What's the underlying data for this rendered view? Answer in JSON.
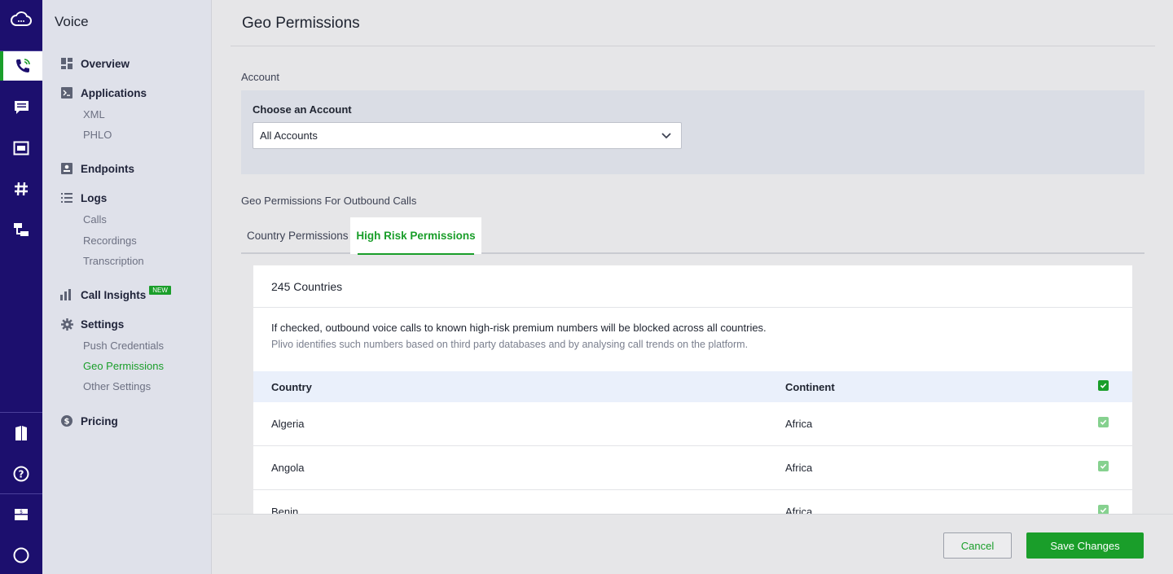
{
  "rail": {
    "items": [
      "cloud-icon",
      "phone-icon",
      "message-icon",
      "sip-icon",
      "hash-icon",
      "flow-icon",
      "book-icon",
      "help-icon",
      "billing-icon",
      "account-icon"
    ],
    "active": "phone-icon"
  },
  "subnav": {
    "title": "Voice",
    "overview": "Overview",
    "applications": "Applications",
    "xml": "XML",
    "phlo": "PHLO",
    "endpoints": "Endpoints",
    "logs": "Logs",
    "calls": "Calls",
    "recordings": "Recordings",
    "transcription": "Transcription",
    "call_insights": "Call Insights",
    "new_badge": "NEW",
    "settings": "Settings",
    "push_credentials": "Push Credentials",
    "geo_permissions": "Geo Permissions",
    "other_settings": "Other Settings",
    "pricing": "Pricing"
  },
  "page": {
    "title": "Geo Permissions",
    "account_label": "Account",
    "choose_label": "Choose an Account",
    "selected_account": "All Accounts",
    "outbound_label": "Geo Permissions For Outbound Calls"
  },
  "tabs": [
    {
      "label": "Country Permissions",
      "active": false
    },
    {
      "label": "High Risk Permissions",
      "active": true
    }
  ],
  "card": {
    "count_label": "245 Countries",
    "desc_main": "If checked, outbound voice calls to known high-risk premium numbers will be blocked across all countries.",
    "desc_sub": "Plivo identifies such numbers based on third party databases and by analysing call trends on the platform.",
    "col_country": "Country",
    "col_continent": "Continent",
    "rows": [
      {
        "country": "Algeria",
        "continent": "Africa",
        "checked": true
      },
      {
        "country": "Angola",
        "continent": "Africa",
        "checked": true
      },
      {
        "country": "Benin",
        "continent": "Africa",
        "checked": true
      }
    ]
  },
  "footer": {
    "cancel": "Cancel",
    "save": "Save Changes"
  },
  "colors": {
    "accent": "#1a9e2a",
    "rail": "#1c0f6e"
  }
}
